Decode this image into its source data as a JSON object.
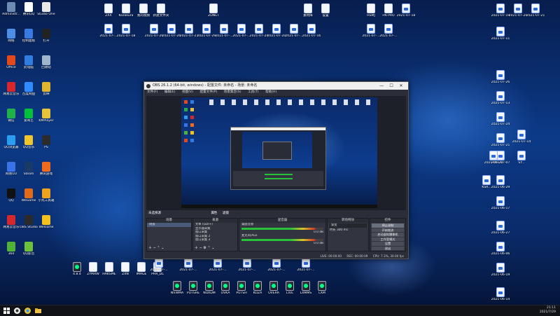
{
  "desktop": {
    "left_column": [
      {
        "label": "Administr...",
        "kind": "user",
        "color": "#6c8cb4"
      },
      {
        "label": "腾讯QQ",
        "kind": "app",
        "color": "#ffffff"
      },
      {
        "label": "Studio One",
        "kind": "app",
        "color": "#e8e8e8"
      },
      {
        "label": "网络",
        "kind": "app",
        "color": "#4d8ee8"
      },
      {
        "label": "控制面板",
        "kind": "app",
        "color": "#3a7ae0"
      },
      {
        "label": "打开",
        "kind": "app",
        "color": "#222222"
      },
      {
        "label": "Office",
        "kind": "app",
        "color": "#e14a1b"
      },
      {
        "label": "此电脑",
        "kind": "app",
        "color": "#2f7de1"
      },
      {
        "label": "回收站",
        "kind": "app",
        "color": "#9fb5cc"
      },
      {
        "label": "网易云音乐",
        "kind": "app",
        "color": "#d3292e"
      },
      {
        "label": "百度网盘",
        "kind": "app",
        "color": "#2f8cff"
      },
      {
        "label": "剪映",
        "kind": "app",
        "color": "#e1b530"
      },
      {
        "label": "微信",
        "kind": "app",
        "color": "#21b14a"
      },
      {
        "label": "爱奇艺",
        "kind": "app",
        "color": "#00c23a"
      },
      {
        "label": "KMPlayer",
        "kind": "app",
        "color": "#e8c33a"
      },
      {
        "label": "QQ浏览器",
        "kind": "app",
        "color": "#2b9cf0"
      },
      {
        "label": "QQ音乐",
        "kind": "app",
        "color": "#f0c52c"
      },
      {
        "label": "PS",
        "kind": "app",
        "color": "#2b2b2b"
      },
      {
        "label": "网易UU",
        "kind": "app",
        "color": "#3a72e8"
      },
      {
        "label": "Steam",
        "kind": "app",
        "color": "#1c3a66"
      },
      {
        "label": "腾讯游戏",
        "kind": "app",
        "color": "#f26b1d"
      },
      {
        "label": "QQ",
        "kind": "app",
        "color": "#111111"
      },
      {
        "label": "WeGame",
        "kind": "app",
        "color": "#e06c1a"
      },
      {
        "label": "小丸工具箱",
        "kind": "app",
        "color": "#f0a31d"
      },
      {
        "label": "网易云音乐",
        "kind": "app",
        "color": "#d3292e"
      },
      {
        "label": "OBS Studio",
        "kind": "app",
        "color": "#2a2a2a"
      },
      {
        "label": "Welcome",
        "kind": "app",
        "color": "#f5c21d"
      },
      {
        "label": "360",
        "kind": "app",
        "color": "#4fb339"
      },
      {
        "label": "QQ影音",
        "kind": "app",
        "color": "#6cc13a"
      }
    ],
    "top_row": [
      {
        "label": "ZXX",
        "kind": "blank"
      },
      {
        "label": "Kozakura",
        "kind": "blank"
      },
      {
        "label": "我的视频",
        "kind": "blank"
      },
      {
        "label": "新建文件夹",
        "kind": "blank"
      },
      {
        "label": "ZDNET",
        "kind": "blank"
      },
      {
        "label": "素材库",
        "kind": "blank"
      },
      {
        "label": "设置",
        "kind": "blank"
      },
      {
        "label": "HSMJ",
        "kind": "blank"
      },
      {
        "label": "FN-PRO",
        "kind": "blank"
      },
      {
        "label": "2021-07-18",
        "kind": "doc"
      },
      {
        "label": "2021-07-19",
        "kind": "doc"
      },
      {
        "label": "2021-07-20",
        "kind": "doc"
      },
      {
        "label": "2021-07-21",
        "kind": "doc"
      }
    ],
    "row2": [
      {
        "label": "2021-07-...",
        "kind": "doc"
      },
      {
        "label": "2021-07-18",
        "kind": "doc"
      },
      {
        "label": "2021-07-26",
        "kind": "doc"
      },
      {
        "label": "2021-07-26",
        "kind": "doc"
      },
      {
        "label": "2021-07-27",
        "kind": "doc"
      },
      {
        "label": "2021-07-29",
        "kind": "doc"
      },
      {
        "label": "2021-07-...",
        "kind": "doc"
      },
      {
        "label": "2021-07-...",
        "kind": "doc"
      },
      {
        "label": "2021-07-24",
        "kind": "doc"
      },
      {
        "label": "2021-07-20",
        "kind": "doc"
      },
      {
        "label": "2021-07-...",
        "kind": "doc"
      },
      {
        "label": "2021-07-16",
        "kind": "doc"
      },
      {
        "label": "2021-07-...",
        "kind": "doc"
      },
      {
        "label": "2021-07-...",
        "kind": "doc"
      }
    ],
    "right_area": [
      {
        "label": "2021-07-11",
        "kind": "doc"
      },
      {
        "label": "2021-07-26",
        "kind": "doc"
      },
      {
        "label": "2021-07-13",
        "kind": "doc"
      },
      {
        "label": "2021-07-24",
        "kind": "doc"
      },
      {
        "label": "2021-07-21",
        "kind": "doc"
      },
      {
        "label": "2021-07-14",
        "kind": "doc"
      },
      {
        "label": "2021-07-07",
        "kind": "doc"
      },
      {
        "label": "2021-06-24",
        "kind": "doc"
      },
      {
        "label": "SY...",
        "kind": "doc"
      },
      {
        "label": "KSR...",
        "kind": "doc"
      },
      {
        "label": "2021-06-29",
        "kind": "doc"
      },
      {
        "label": "2021-06-17",
        "kind": "doc"
      },
      {
        "label": "2021-06-27",
        "kind": "doc"
      },
      {
        "label": "2021-06-06",
        "kind": "doc"
      },
      {
        "label": "2021-06-19",
        "kind": "doc"
      },
      {
        "label": "2021-06-14",
        "kind": "doc"
      }
    ],
    "bottom_rows": [
      {
        "label": "4.8.4",
        "kind": "vid"
      },
      {
        "label": "ZYMXW",
        "kind": "blank"
      },
      {
        "label": "HAKSME",
        "kind": "blank"
      },
      {
        "label": "ZXN",
        "kind": "blank"
      },
      {
        "label": "IMAGE",
        "kind": "blank"
      },
      {
        "label": "PHR_DL",
        "kind": "blank"
      },
      {
        "label": "2021-07-...",
        "kind": "doc"
      },
      {
        "label": "2021-07-...",
        "kind": "doc"
      },
      {
        "label": "2021-07-...",
        "kind": "doc"
      },
      {
        "label": "2021-07-...",
        "kind": "doc"
      },
      {
        "label": "2021-07-...",
        "kind": "doc"
      },
      {
        "label": "2021-07-...",
        "kind": "doc"
      },
      {
        "label": "NVWMA",
        "kind": "vid"
      },
      {
        "label": "PUTSHE",
        "kind": "vid"
      },
      {
        "label": "NOXDM",
        "kind": "vid"
      },
      {
        "label": "OVKA",
        "kind": "vid"
      },
      {
        "label": "PUTSH",
        "kind": "vid"
      },
      {
        "label": "KOZA",
        "kind": "vid"
      },
      {
        "label": "OVERA",
        "kind": "vid"
      },
      {
        "label": "LIVE",
        "kind": "vid"
      },
      {
        "label": "LXMMS",
        "kind": "vid"
      },
      {
        "label": "LXM",
        "kind": "vid"
      }
    ]
  },
  "obs": {
    "title": "OBS 26.1.2 (64-bit, windows) - 配置文件: 未命名 - 场景: 未命名",
    "window_buttons": [
      "—",
      "☐",
      "✕"
    ],
    "menu": [
      "文件(F)",
      "编辑(E)",
      "视图(V)",
      "配置文件(P)",
      "场景集合(S)",
      "工具(T)",
      "帮助(H)"
    ],
    "preview_label": "未选择源",
    "panel_buttons": [
      "属性",
      "滤镜"
    ],
    "panels": {
      "scenes": {
        "title": "场景",
        "items": [
          "场景"
        ]
      },
      "sources": {
        "title": "来源",
        "items": [
          "文本 (GDI+)",
          "显示器采集",
          "窗口采集",
          "窗口采集 2",
          "窗口采集 3"
        ]
      },
      "mixer": {
        "title": "混音器",
        "channels": [
          {
            "name": "桌面音频",
            "db": "0.0 dB"
          },
          {
            "name": "麦克风/Aux",
            "db": "0.0 dB"
          }
        ]
      },
      "transitions": {
        "title": "转场特效",
        "type": "渐变",
        "duration_label": "时长",
        "duration": "300 ms"
      },
      "controls": {
        "title": "控件",
        "buttons": [
          "停止录制",
          "开始推流",
          "启动虚拟摄像机",
          "工作室模式",
          "设置",
          "退出"
        ]
      }
    },
    "statusbar": {
      "live": "LIVE: 00:00:00",
      "rec": "REC: 00:00:09",
      "cpu": "CPU: 7.3%, 30.00 fps"
    }
  },
  "taskbar": {
    "buttons": [
      "windows-start",
      "search",
      "task-view",
      "file-explorer",
      "obs",
      "chrome"
    ],
    "time": "21:11",
    "date": "2021/7/29"
  }
}
